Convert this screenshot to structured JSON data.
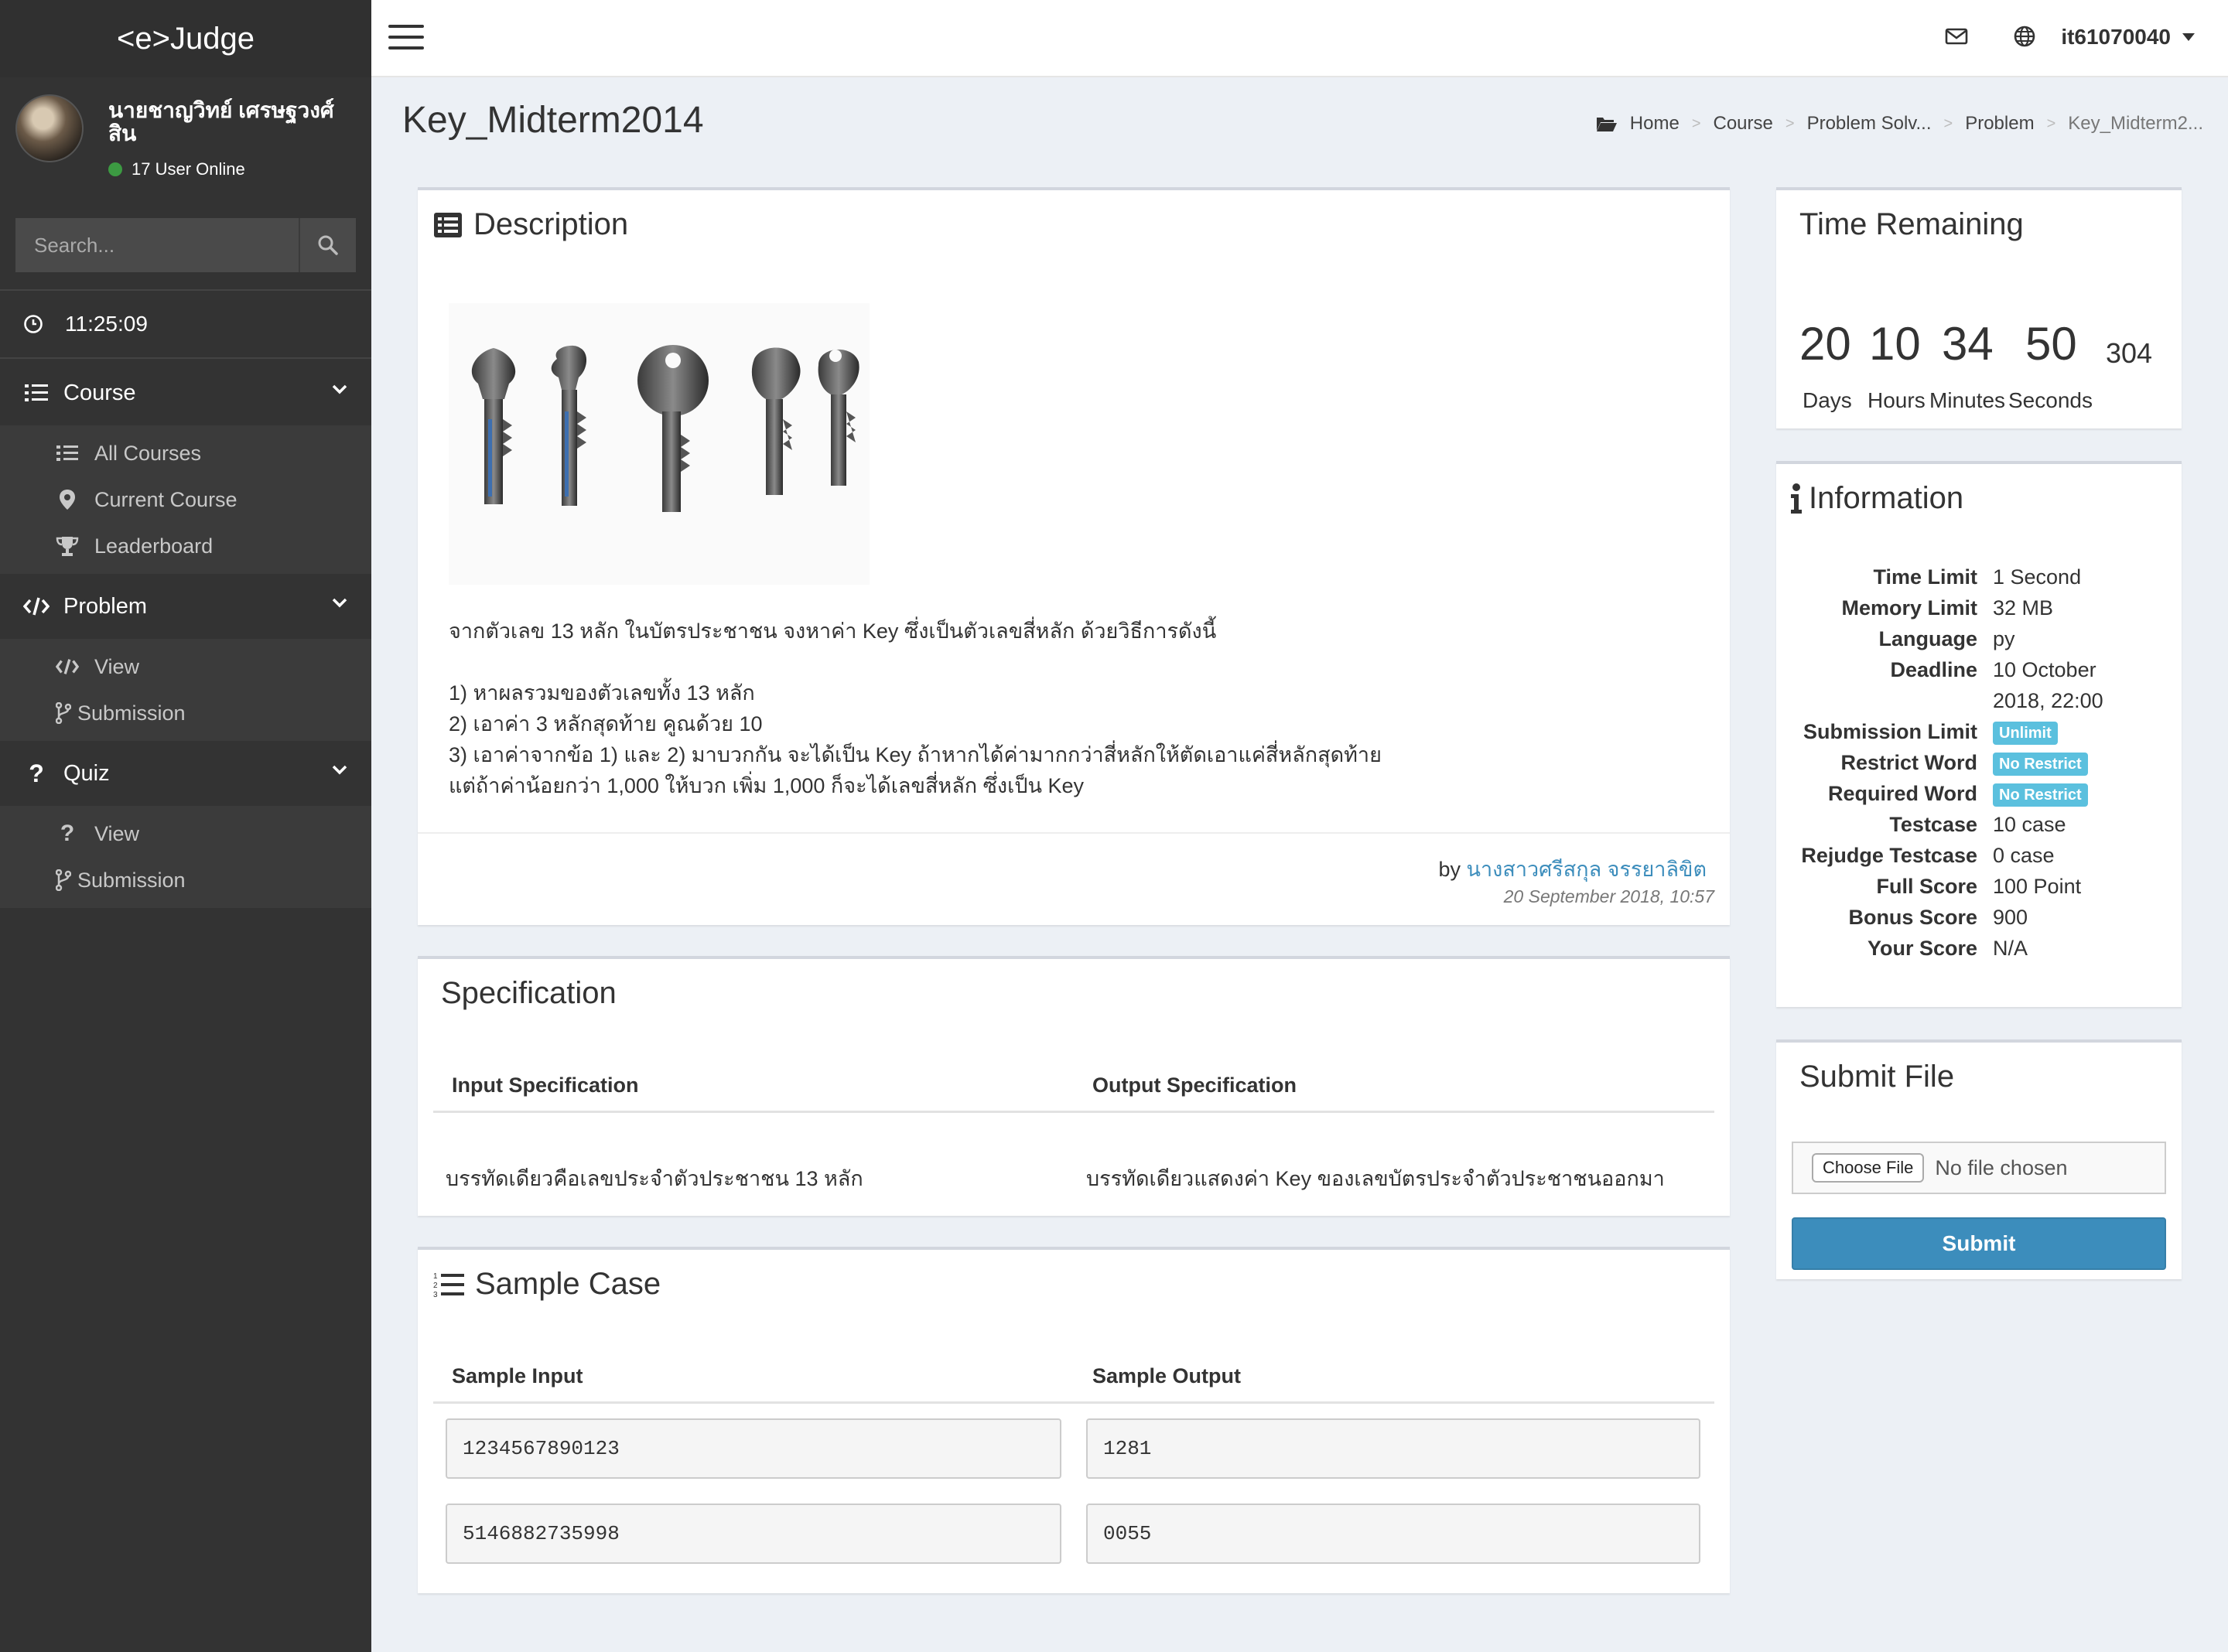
{
  "app": {
    "logo": "<e>Judge"
  },
  "user": {
    "name": "นายชาญวิทย์ เศรษฐวงศ์สิน",
    "online": "17 User Online",
    "username": "it61070040"
  },
  "sidebar": {
    "search_placeholder": "Search...",
    "clock": "11:25:09",
    "course": {
      "label": "Course",
      "items": [
        "All Courses",
        "Current Course",
        "Leaderboard"
      ]
    },
    "problem": {
      "label": "Problem",
      "items": [
        "View",
        "Submission"
      ]
    },
    "quiz": {
      "label": "Quiz",
      "items": [
        "View",
        "Submission"
      ]
    }
  },
  "page": {
    "title": "Key_Midterm2014",
    "breadcrumb": [
      "Home",
      "Course",
      "Problem Solv...",
      "Problem",
      "Key_Midterm2..."
    ]
  },
  "description": {
    "title": "Description",
    "lines": [
      "จากตัวเลข 13 หลัก ในบัตรประชาชน จงหาค่า Key ซึ่งเป็นตัวเลขสี่หลัก ด้วยวิธีการดังนี้",
      "",
      "1) หาผลรวมของตัวเลขทั้ง 13 หลัก",
      "2) เอาค่า 3 หลักสุดท้าย คูณด้วย 10",
      "3) เอาค่าจากข้อ 1) และ 2) มาบวกกัน จะได้เป็น Key ถ้าหากได้ค่ามากกว่าสี่หลักให้ตัดเอาแค่สี่หลักสุดท้าย",
      "แต่ถ้าค่าน้อยกว่า 1,000 ให้บวก เพิ่ม 1,000 ก็จะได้เลขสี่หลัก ซึ่งเป็น Key"
    ],
    "by": "by",
    "author": "นางสาวศรีสกุล จรรยาลิขิต",
    "date": "20 September 2018, 10:57"
  },
  "specification": {
    "title": "Specification",
    "input_header": "Input Specification",
    "output_header": "Output Specification",
    "input": "บรรทัดเดียวคือเลขประจำตัวประชาชน 13 หลัก",
    "output": "บรรทัดเดียวแสดงค่า Key ของเลขบัตรประจำตัวประชาชนออกมา"
  },
  "sample": {
    "title": "Sample Case",
    "input_header": "Sample Input",
    "output_header": "Sample Output",
    "rows": [
      {
        "input": "1234567890123",
        "output": "1281"
      },
      {
        "input": "5146882735998",
        "output": "0055"
      }
    ]
  },
  "time_remaining": {
    "title": "Time Remaining",
    "days": "20",
    "hours": "10",
    "minutes": "34",
    "seconds": "50",
    "ms": "304",
    "days_label": "Days",
    "hours_label": "Hours",
    "minutes_label": "Minutes",
    "seconds_label": "Seconds"
  },
  "information": {
    "title": "Information",
    "rows": [
      {
        "key": "Time Limit",
        "value": "1 Second"
      },
      {
        "key": "Memory Limit",
        "value": "32 MB"
      },
      {
        "key": "Language",
        "value": "py"
      },
      {
        "key": "Deadline",
        "value": "10 October 2018, 22:00"
      },
      {
        "key": "Submission Limit",
        "value": "Unlimit"
      },
      {
        "key": "Restrict Word",
        "value": "No Restrict"
      },
      {
        "key": "Required Word",
        "value": "No Restrict"
      },
      {
        "key": "Testcase",
        "value": "10 case"
      },
      {
        "key": "Rejudge Testcase",
        "value": "0 case"
      },
      {
        "key": "Full Score",
        "value": "100 Point"
      },
      {
        "key": "Bonus Score",
        "value": "900"
      },
      {
        "key": "Your Score",
        "value": "N/A"
      }
    ]
  },
  "submit": {
    "title": "Submit File",
    "choose_label": "Choose File",
    "no_file": "No file chosen",
    "submit_label": "Submit"
  },
  "colors": {
    "accent": "#3c8dbc",
    "badge": "#5bc0de",
    "sidebar": "#333333",
    "online": "#3c9a42"
  }
}
